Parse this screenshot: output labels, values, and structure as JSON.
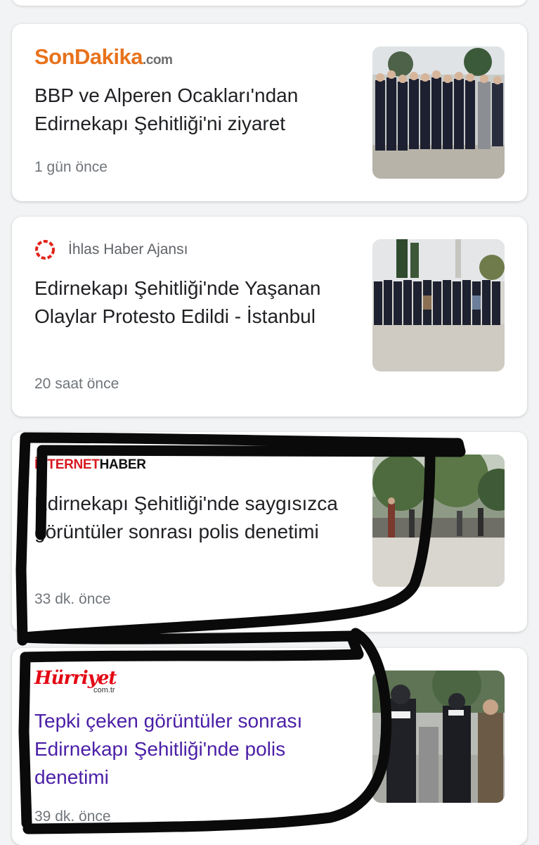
{
  "articles": [
    {
      "source": {
        "logo_main": "SonDakika",
        "logo_domain": ".com"
      },
      "headline": "BBP ve Alperen Ocakları'ndan Edirnekapı Şehitliği'ni ziyaret",
      "time": "1 gün önce"
    },
    {
      "source": {
        "name": "İhlas Haber Ajansı"
      },
      "headline": "Edirnekapı Şehitliği'nde Yaşanan Olaylar Protesto Edildi - İstanbul",
      "time": "20 saat önce"
    },
    {
      "source": {
        "logo_prefix": "İNTERNET",
        "logo_suffix": "HABER"
      },
      "headline": "Edirnekapı Şehitliği'nde saygısızca görüntüler sonrası polis denetimi",
      "time": "33 dk. önce"
    },
    {
      "source": {
        "logo_main": "Hürriyet",
        "logo_domain": "com.tr"
      },
      "headline": "Tepki çeken görüntüler sonrası Edirnekapı Şehitliği'nde polis denetimi",
      "time": "39 dk. önce"
    }
  ],
  "colors": {
    "headline": "#202124",
    "visited_headline": "#4b1fa6",
    "meta": "#70757a",
    "sondakika_orange": "#e8721c",
    "hurriyet_red": "#e30613",
    "iha_red": "#e2231a",
    "marker": "#0a0a0a"
  }
}
